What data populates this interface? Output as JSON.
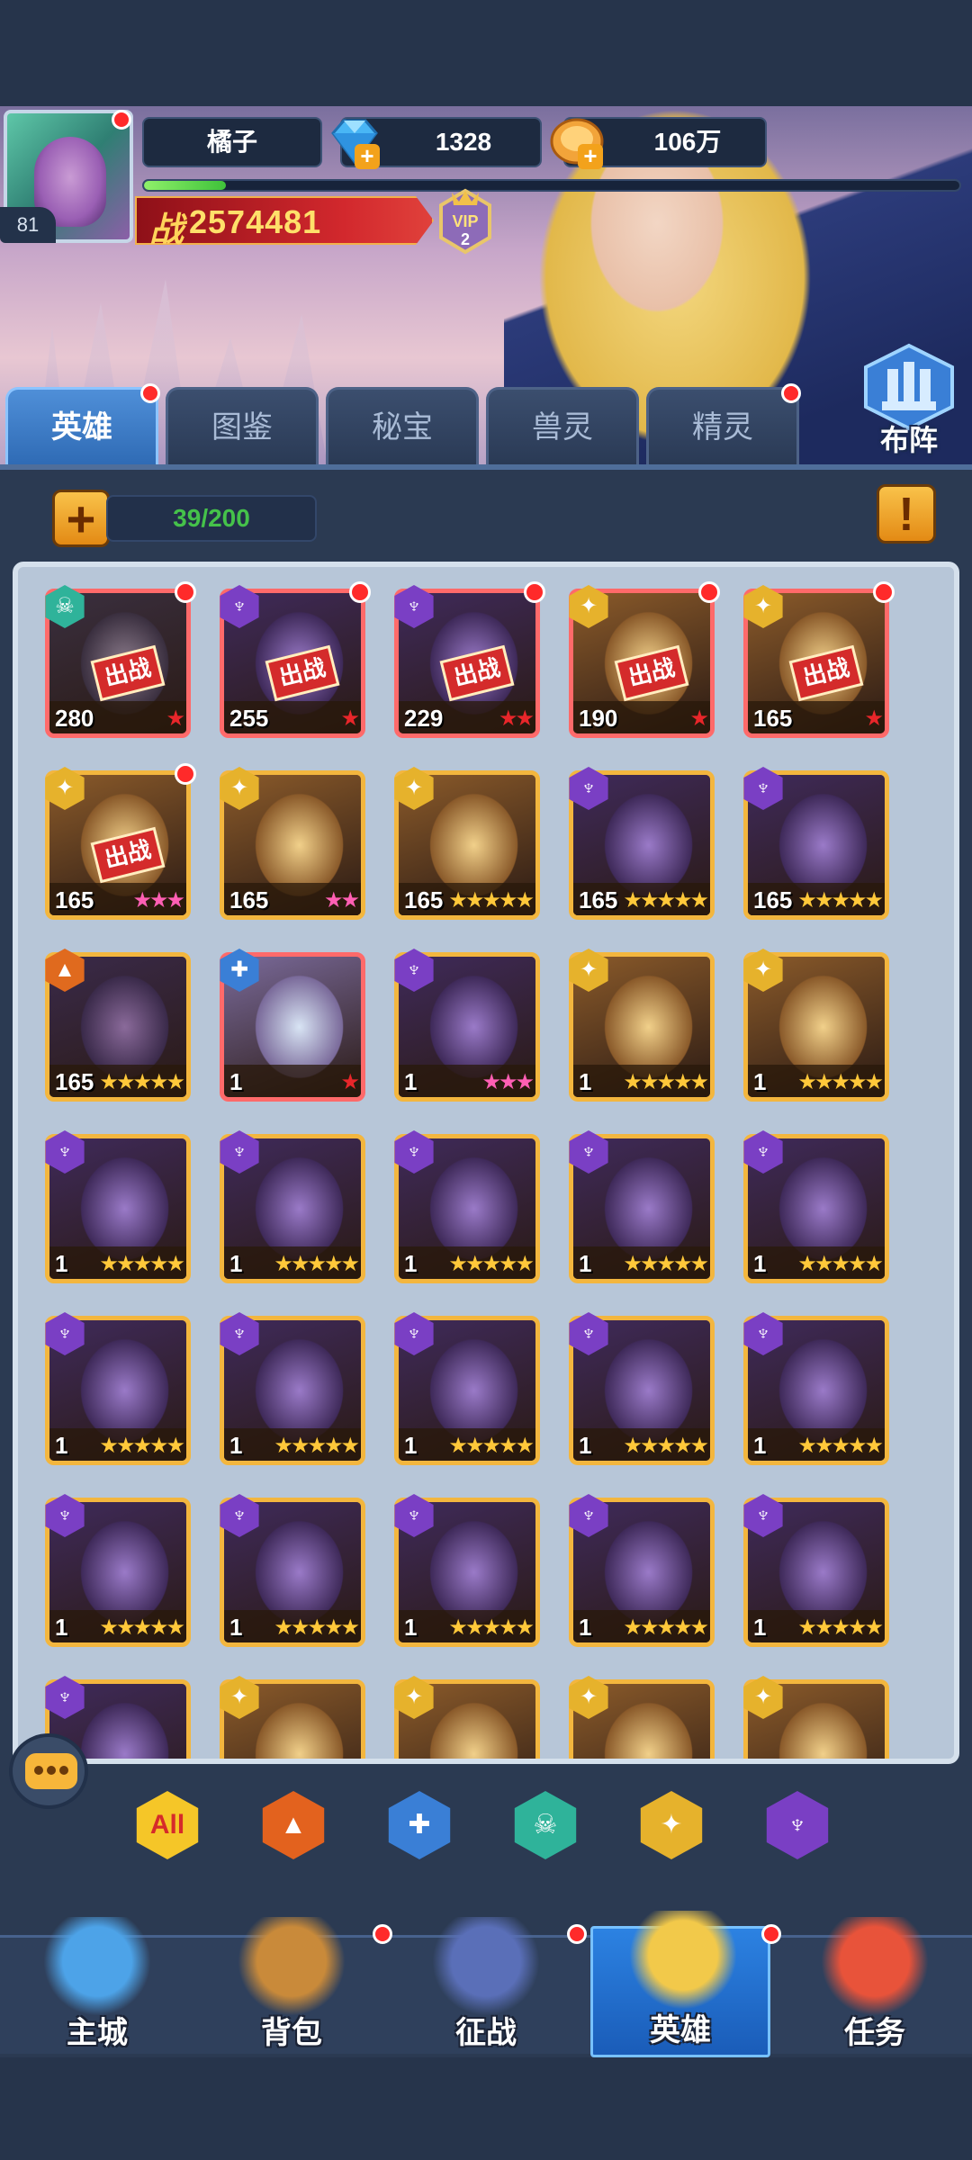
{
  "player": {
    "name": "橘子",
    "level": "81",
    "gems": "1328",
    "gold": "106万",
    "power_label": "战",
    "power": "2574481",
    "vip": "VIP",
    "vip_level": "2",
    "exp_fraction": 0.1
  },
  "formation_button": "布阵",
  "tabs": [
    {
      "label": "英雄",
      "active": true,
      "dot": true
    },
    {
      "label": "图鉴",
      "active": false,
      "dot": false
    },
    {
      "label": "秘宝",
      "active": false,
      "dot": false
    },
    {
      "label": "兽灵",
      "active": false,
      "dot": false
    },
    {
      "label": "精灵",
      "active": false,
      "dot": true
    }
  ],
  "roster_count": "39/200",
  "deployed_label": "出战",
  "heroes": [
    {
      "faction": "undead",
      "level": "280",
      "deployed": true,
      "dot": true,
      "stars": 1,
      "star_color": "red",
      "style": "red"
    },
    {
      "faction": "dark",
      "level": "255",
      "deployed": true,
      "dot": true,
      "stars": 1,
      "star_color": "red",
      "style": "red"
    },
    {
      "faction": "dark",
      "level": "229",
      "deployed": true,
      "dot": true,
      "stars": 2,
      "star_color": "red",
      "style": "red"
    },
    {
      "faction": "light",
      "level": "190",
      "deployed": true,
      "dot": true,
      "stars": 1,
      "star_color": "red",
      "style": "red"
    },
    {
      "faction": "light",
      "level": "165",
      "deployed": true,
      "dot": true,
      "stars": 1,
      "star_color": "red",
      "style": "red"
    },
    {
      "faction": "light",
      "level": "165",
      "deployed": true,
      "dot": true,
      "stars": 3,
      "star_color": "pink",
      "style": "gold"
    },
    {
      "faction": "light",
      "level": "165",
      "deployed": false,
      "dot": false,
      "stars": 2,
      "star_color": "pink",
      "style": "gold"
    },
    {
      "faction": "light",
      "level": "165",
      "deployed": false,
      "dot": false,
      "stars": 5,
      "star_color": "gold",
      "style": "gold"
    },
    {
      "faction": "dark",
      "level": "165",
      "deployed": false,
      "dot": false,
      "stars": 5,
      "star_color": "gold",
      "style": "gold"
    },
    {
      "faction": "dark",
      "level": "165",
      "deployed": false,
      "dot": false,
      "stars": 5,
      "star_color": "gold",
      "style": "gold"
    },
    {
      "faction": "fire",
      "level": "165",
      "deployed": false,
      "dot": false,
      "stars": 5,
      "star_color": "gold",
      "style": "gold"
    },
    {
      "faction": "water",
      "level": "1",
      "deployed": false,
      "dot": false,
      "stars": 1,
      "star_color": "red",
      "style": "red"
    },
    {
      "faction": "dark",
      "level": "1",
      "deployed": false,
      "dot": false,
      "stars": 3,
      "star_color": "pink",
      "style": "gold"
    },
    {
      "faction": "light",
      "level": "1",
      "deployed": false,
      "dot": false,
      "stars": 5,
      "star_color": "gold",
      "style": "gold"
    },
    {
      "faction": "light",
      "level": "1",
      "deployed": false,
      "dot": false,
      "stars": 5,
      "star_color": "gold",
      "style": "gold"
    },
    {
      "faction": "dark",
      "level": "1",
      "deployed": false,
      "dot": false,
      "stars": 5,
      "star_color": "gold",
      "style": "gold"
    },
    {
      "faction": "dark",
      "level": "1",
      "deployed": false,
      "dot": false,
      "stars": 5,
      "star_color": "gold",
      "style": "gold"
    },
    {
      "faction": "dark",
      "level": "1",
      "deployed": false,
      "dot": false,
      "stars": 5,
      "star_color": "gold",
      "style": "gold"
    },
    {
      "faction": "dark",
      "level": "1",
      "deployed": false,
      "dot": false,
      "stars": 5,
      "star_color": "gold",
      "style": "gold"
    },
    {
      "faction": "dark",
      "level": "1",
      "deployed": false,
      "dot": false,
      "stars": 5,
      "star_color": "gold",
      "style": "gold"
    },
    {
      "faction": "dark",
      "level": "1",
      "deployed": false,
      "dot": false,
      "stars": 5,
      "star_color": "gold",
      "style": "gold"
    },
    {
      "faction": "dark",
      "level": "1",
      "deployed": false,
      "dot": false,
      "stars": 5,
      "star_color": "gold",
      "style": "gold"
    },
    {
      "faction": "dark",
      "level": "1",
      "deployed": false,
      "dot": false,
      "stars": 5,
      "star_color": "gold",
      "style": "gold"
    },
    {
      "faction": "dark",
      "level": "1",
      "deployed": false,
      "dot": false,
      "stars": 5,
      "star_color": "gold",
      "style": "gold"
    },
    {
      "faction": "dark",
      "level": "1",
      "deployed": false,
      "dot": false,
      "stars": 5,
      "star_color": "gold",
      "style": "gold"
    },
    {
      "faction": "dark",
      "level": "1",
      "deployed": false,
      "dot": false,
      "stars": 5,
      "star_color": "gold",
      "style": "gold"
    },
    {
      "faction": "dark",
      "level": "1",
      "deployed": false,
      "dot": false,
      "stars": 5,
      "star_color": "gold",
      "style": "gold"
    },
    {
      "faction": "dark",
      "level": "1",
      "deployed": false,
      "dot": false,
      "stars": 5,
      "star_color": "gold",
      "style": "gold"
    },
    {
      "faction": "dark",
      "level": "1",
      "deployed": false,
      "dot": false,
      "stars": 5,
      "star_color": "gold",
      "style": "gold"
    },
    {
      "faction": "dark",
      "level": "1",
      "deployed": false,
      "dot": false,
      "stars": 5,
      "star_color": "gold",
      "style": "gold"
    },
    {
      "faction": "dark",
      "level": "",
      "deployed": false,
      "dot": false,
      "stars": 0,
      "star_color": "gold",
      "style": "gold"
    },
    {
      "faction": "light",
      "level": "",
      "deployed": false,
      "dot": false,
      "stars": 0,
      "star_color": "gold",
      "style": "gold"
    },
    {
      "faction": "light",
      "level": "",
      "deployed": false,
      "dot": false,
      "stars": 0,
      "star_color": "gold",
      "style": "gold"
    },
    {
      "faction": "light",
      "level": "",
      "deployed": false,
      "dot": false,
      "stars": 0,
      "star_color": "gold",
      "style": "gold"
    },
    {
      "faction": "light",
      "level": "",
      "deployed": false,
      "dot": false,
      "stars": 0,
      "star_color": "gold",
      "style": "gold"
    }
  ],
  "filters": [
    {
      "name": "all",
      "label": "All"
    },
    {
      "name": "fire",
      "label": ""
    },
    {
      "name": "water",
      "label": ""
    },
    {
      "name": "undead",
      "label": ""
    },
    {
      "name": "light",
      "label": ""
    },
    {
      "name": "dark",
      "label": ""
    }
  ],
  "nav": [
    {
      "label": "主城",
      "active": false,
      "dot": false
    },
    {
      "label": "背包",
      "active": false,
      "dot": true
    },
    {
      "label": "征战",
      "active": false,
      "dot": true
    },
    {
      "label": "英雄",
      "active": true,
      "dot": true
    },
    {
      "label": "任务",
      "active": false,
      "dot": false
    }
  ],
  "colors": {
    "accent": "#2f6bb5",
    "gold": "#e2a839",
    "red_dot": "#ff2a2a",
    "count_green": "#45c24a"
  }
}
